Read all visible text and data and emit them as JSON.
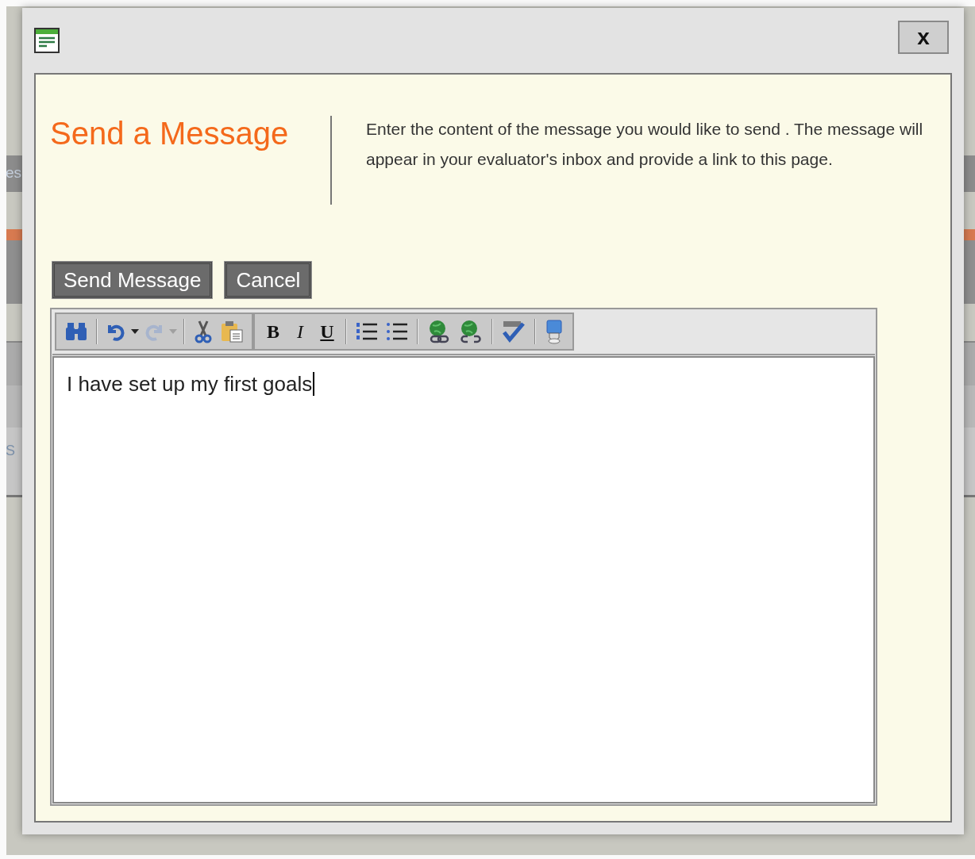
{
  "background": {
    "fragments": [
      "es",
      "S"
    ]
  },
  "dialog": {
    "close_label": "x",
    "heading": "Send a Message",
    "description": "Enter the content of the message you would like to send . The message will appear in your evaluator's inbox and provide a link to this page.",
    "buttons": [
      {
        "label": "Send Message"
      },
      {
        "label": "Cancel"
      }
    ],
    "toolbar": {
      "groups": [
        [
          {
            "kind": "find",
            "disabled": false
          },
          {
            "kind": "sep"
          },
          {
            "kind": "undo",
            "disabled": false
          },
          {
            "kind": "undo-menu",
            "disabled": false
          },
          {
            "kind": "redo",
            "disabled": true
          },
          {
            "kind": "redo-menu",
            "disabled": true
          },
          {
            "kind": "sep"
          },
          {
            "kind": "cut",
            "disabled": false
          },
          {
            "kind": "paste",
            "disabled": false
          }
        ],
        [
          {
            "kind": "bold",
            "label": "B",
            "disabled": false
          },
          {
            "kind": "italic",
            "label": "I",
            "disabled": false
          },
          {
            "kind": "underline",
            "label": "U",
            "disabled": false
          },
          {
            "kind": "sep"
          },
          {
            "kind": "ordered-list",
            "disabled": false
          },
          {
            "kind": "bullet-list",
            "disabled": false
          },
          {
            "kind": "sep"
          },
          {
            "kind": "link",
            "disabled": false
          },
          {
            "kind": "unlink",
            "disabled": false
          },
          {
            "kind": "sep"
          },
          {
            "kind": "spellcheck",
            "disabled": false
          },
          {
            "kind": "sep"
          },
          {
            "kind": "screen",
            "disabled": false
          }
        ]
      ]
    },
    "editor": {
      "value": "I have set up my first goals"
    }
  }
}
